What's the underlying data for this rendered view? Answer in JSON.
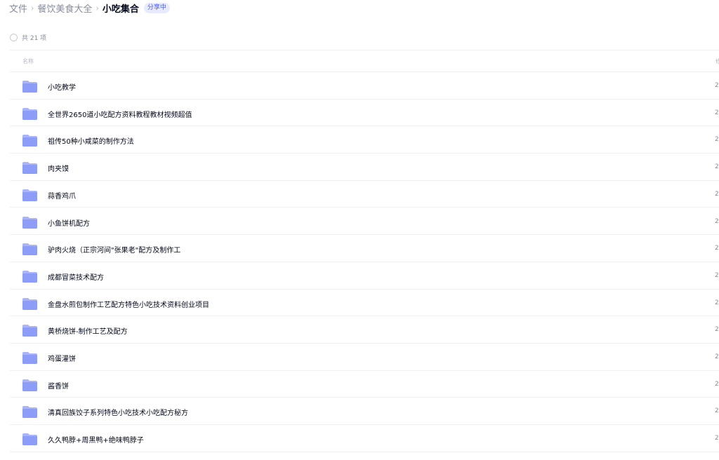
{
  "breadcrumb": {
    "items": [
      "文件",
      "餐饮美食大全"
    ],
    "current": "小吃集合",
    "badge": "分享中"
  },
  "summary": {
    "count_text": "共 21 项"
  },
  "table": {
    "header_name": "名称",
    "header_right": "修",
    "rows": [
      {
        "name": "小吃教学",
        "date": "2"
      },
      {
        "name": "全世界2650道小吃配方资料教程教材视频超值",
        "date": "2"
      },
      {
        "name": "祖传50种小咸菜的制作方法",
        "date": "2"
      },
      {
        "name": "肉夹馍",
        "date": "2"
      },
      {
        "name": "蒜香鸡爪",
        "date": "2"
      },
      {
        "name": "小鱼饼机配方",
        "date": "2"
      },
      {
        "name": "驴肉火烧（正宗河间\"张果老\"配方及制作工",
        "date": "2"
      },
      {
        "name": "成都冒菜技术配方",
        "date": "2"
      },
      {
        "name": "金盘水煎包制作工艺配方特色小吃技术资料创业项目",
        "date": "2"
      },
      {
        "name": "黄桥烧饼-制作工艺及配方",
        "date": "2"
      },
      {
        "name": "鸡蛋灌饼",
        "date": "2"
      },
      {
        "name": "酱香饼",
        "date": "2"
      },
      {
        "name": "清真回族饺子系列特色小吃技术小吃配方秘方",
        "date": "2"
      },
      {
        "name": "久久鸭脖+周黑鸭+绝味鸭脖子",
        "date": "2"
      }
    ]
  },
  "colors": {
    "folder": "#8d9cf6",
    "folder_tab": "#a9b4fa",
    "accent": "#4a5cf0"
  },
  "icons": {
    "folder": "folder-icon",
    "select": "select-all-checkbox"
  }
}
